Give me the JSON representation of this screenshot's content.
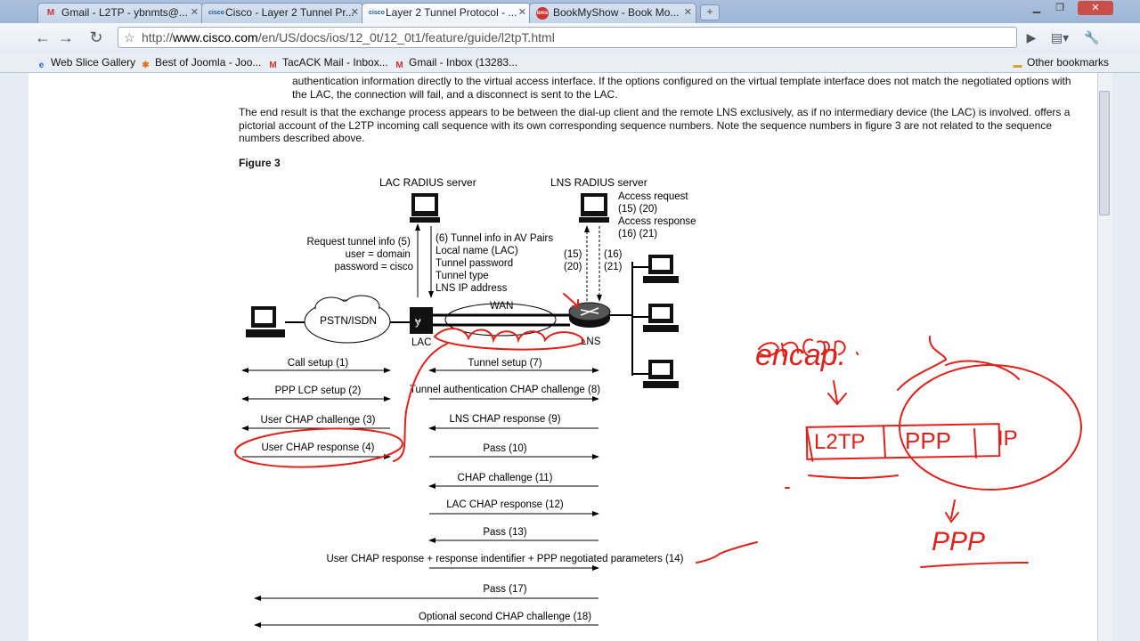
{
  "tabs": [
    {
      "label": "Gmail - L2TP - ybnmts@...",
      "icon": "gmail-icon"
    },
    {
      "label": "Cisco - Layer 2 Tunnel Pr...",
      "icon": "cisco-icon"
    },
    {
      "label": "Layer 2 Tunnel Protocol - ...",
      "icon": "cisco-icon"
    },
    {
      "label": "BookMyShow - Book Mo...",
      "icon": "bms-icon"
    }
  ],
  "url": {
    "prefix": "http://",
    "domain": "www.cisco.com",
    "path": "/en/US/docs/ios/12_0t/12_0t1/feature/guide/l2tpT.html"
  },
  "bookmarks": [
    {
      "label": "Web Slice Gallery",
      "icon": "ie-icon"
    },
    {
      "label": "Best of Joomla - Joo...",
      "icon": "joomla-icon"
    },
    {
      "label": "TacACK Mail - Inbox...",
      "icon": "gmail-icon"
    },
    {
      "label": "Gmail - Inbox (13283...",
      "icon": "gmail-icon"
    }
  ],
  "other_bookmarks": "Other bookmarks",
  "doc": {
    "para1": [
      "authentication information directly to the virtual access interface. If the options configured on the virtual template interface does not match the negotiated options with",
      "the LAC, the connection will fail, and a disconnect is sent to the LAC."
    ],
    "para2": [
      "The end result is that the exchange process appears to be between the dial-up client and the remote LNS exclusively, as if no intermediary device (the LAC) is involved. offers a",
      "pictorial account of the L2TP incoming call sequence with its own corresponding sequence numbers. Note the sequence numbers in figure 3 are not related to the sequence",
      "numbers described above."
    ],
    "figure_label": "Figure 3"
  },
  "diagram": {
    "lac_radius": "LAC RADIUS server",
    "lns_radius": "LNS RADIUS server",
    "access": [
      "Access request",
      "(15) (20)",
      "Access response",
      "(16) (21)"
    ],
    "request_tunnel": [
      "Request tunnel info (5)",
      "user = domain",
      "password = cisco"
    ],
    "tunnel_info": [
      "(6) Tunnel info in AV Pairs",
      "Local name (LAC)",
      "Tunnel password",
      "Tunnel type",
      "LNS IP address"
    ],
    "left_nums": [
      "(15)",
      "(20)"
    ],
    "right_nums": [
      "(16)",
      "(21)"
    ],
    "pstn": "PSTN/ISDN",
    "wan": "WAN",
    "lac": "LAC",
    "lns": "LNS",
    "messages": [
      "Call setup (1)",
      "PPP LCP setup (2)",
      "User CHAP challenge (3)",
      "User CHAP response (4)",
      "Tunnel setup (7)",
      "Tunnel authentication CHAP challenge (8)",
      "LNS CHAP response (9)",
      "Pass (10)",
      "CHAP challenge (11)",
      "LAC CHAP response (12)",
      "Pass (13)",
      "User CHAP response + response indentifier + PPP negotiated parameters (14)",
      "Pass (17)",
      "Optional second CHAP challenge (18)"
    ]
  },
  "handwriting": {
    "encap": "encap.",
    "l2tp": "L2TP",
    "ppp": "PPP",
    "ip": "IP",
    "ppp2": "PPP"
  }
}
